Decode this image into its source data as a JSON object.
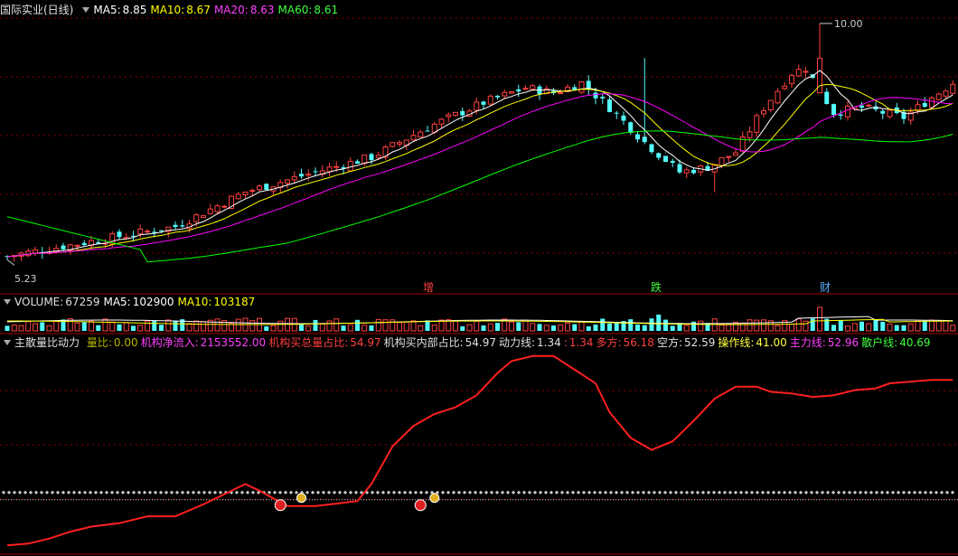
{
  "colors": {
    "up": "#ff4040",
    "down": "#54fcfc",
    "ma5": "#ffffff",
    "ma10": "#ffff00",
    "ma20": "#ff00ff",
    "ma60": "#00ff00",
    "grid": "#8b0000",
    "power_line": "#ff2020",
    "dots": "#c8c8c8"
  },
  "price_panel": {
    "title": "国际实业(日线)",
    "ma5_label": "MA5:",
    "ma5_value": "8.85",
    "ma10_label": "MA10:",
    "ma10_value": "8.67",
    "ma20_label": "MA20:",
    "ma20_value": "8.63",
    "ma60_label": "MA60:",
    "ma60_value": "8.61",
    "high_label": "10.00",
    "low_label": "5.23",
    "markers": [
      "增",
      "跌",
      "财"
    ]
  },
  "volume_panel": {
    "title": "VOLUME:",
    "value": "67259",
    "ma5_label": "MA5:",
    "ma5_value": "102900",
    "ma10_label": "MA10:",
    "ma10_value": "103187"
  },
  "indicator_panel": {
    "title": "主散量比动力",
    "items": [
      {
        "label": "量比:",
        "value": "0.00",
        "color": "#b4b400"
      },
      {
        "label": "机构净流入:",
        "value": "2153552.00",
        "color": "#ff40ff"
      },
      {
        "label": "机构买总量占比:",
        "value": "54.97",
        "color": "#ff4040"
      },
      {
        "label": "机构买内部占比:",
        "value": "54.97",
        "color": "#e0e0e0"
      },
      {
        "label": "动力线:",
        "value": "1.34",
        "color": "#e0e0e0"
      },
      {
        "label": ":",
        "value": "1.34",
        "color": "#ff4040"
      },
      {
        "label": "多方:",
        "value": "56.18",
        "color": "#ff4040"
      },
      {
        "label": "空方:",
        "value": "52.59",
        "color": "#e0e0e0"
      },
      {
        "label": "操作线:",
        "value": "41.00",
        "color": "#ffff40"
      },
      {
        "label": "主力线:",
        "value": "52.96",
        "color": "#ff40ff"
      },
      {
        "label": "散户线:",
        "value": "40.69",
        "color": "#40ff40"
      }
    ]
  },
  "chart_data": {
    "type": "candlestick",
    "price_ylim": [
      5.0,
      10.2
    ],
    "power_x": [
      0,
      3,
      6,
      9,
      12,
      16,
      20,
      24,
      28,
      31,
      34,
      36,
      40,
      44,
      48,
      50,
      52,
      55,
      58,
      61,
      64,
      67,
      70,
      72,
      75,
      78,
      81,
      84,
      86,
      89,
      92,
      95,
      98,
      101,
      104,
      107,
      109,
      112,
      115,
      118,
      121,
      124,
      126,
      129,
      132,
      135
    ],
    "power_y": [
      2,
      3,
      6,
      10,
      13,
      15,
      19,
      19,
      26,
      32,
      38,
      34,
      25,
      25,
      27,
      28,
      38,
      60,
      72,
      79,
      83,
      90,
      103,
      110,
      113,
      113,
      105,
      97,
      80,
      65,
      58,
      63,
      75,
      88,
      95,
      95,
      92,
      91,
      89,
      90,
      93,
      94,
      97,
      98,
      99,
      99
    ],
    "power_ylim": [
      0,
      115
    ],
    "dots_level": 33
  }
}
